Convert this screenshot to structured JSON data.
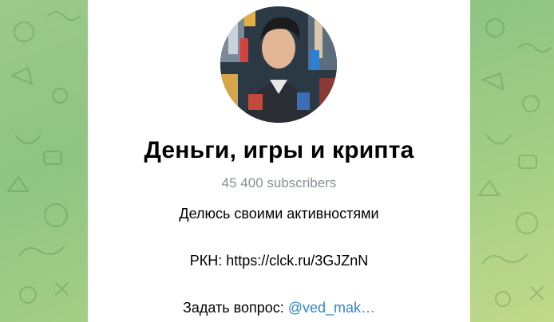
{
  "channel": {
    "title": "Деньги, игры и крипта",
    "subscribers": "45 400 subscribers",
    "description": {
      "line1": "Делюсь своими активностями",
      "line2": "РКН: https://clck.ru/3GJZnN",
      "line3_prefix": "Задать вопрос: ",
      "line3_link": "@ved_mak…"
    }
  },
  "colors": {
    "background": "#9cc98a",
    "card": "#ffffff",
    "title": "#000000",
    "subtitle": "#8a8f94",
    "link": "#2f87c9"
  },
  "icons": {
    "avatar": "channel-avatar-photo"
  }
}
